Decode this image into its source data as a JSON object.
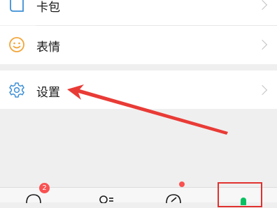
{
  "menu": {
    "items": [
      {
        "label": "卡包",
        "icon": "wallet-icon"
      },
      {
        "label": "表情",
        "icon": "smiley-icon"
      },
      {
        "label": "设置",
        "icon": "gear-icon"
      }
    ]
  },
  "tabbar": {
    "tabs": [
      {
        "icon": "chat-icon",
        "badge": "2"
      },
      {
        "icon": "contacts-icon",
        "badge": ""
      },
      {
        "icon": "discover-icon",
        "badge": "dot"
      },
      {
        "icon": "me-icon",
        "badge": "",
        "active": true
      }
    ]
  },
  "colors": {
    "accent": "#07c160",
    "arrow": "#e93b36",
    "badge": "#fa5151",
    "icon_blue": "#3d8fd6",
    "icon_orange": "#f2a63b"
  }
}
